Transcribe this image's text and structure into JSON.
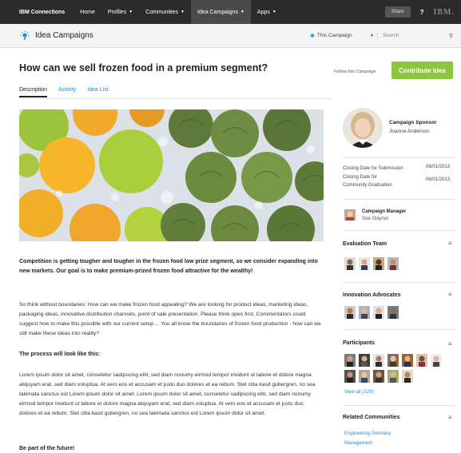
{
  "topnav": {
    "brand": "IBM Connections",
    "items": [
      {
        "label": "Home",
        "caret": false
      },
      {
        "label": "Profiles",
        "caret": true
      },
      {
        "label": "Communities",
        "caret": true
      },
      {
        "label": "Idea Campaigns",
        "caret": true,
        "active": true
      },
      {
        "label": "Apps",
        "caret": true
      }
    ],
    "share_label": "Share",
    "help_label": "?",
    "logo_text": "IBM."
  },
  "titlebar": {
    "title": "Idea Campaigns",
    "scope_label": "This Campaign",
    "search_placeholder": "Search"
  },
  "page": {
    "headline": "How can we sell frozen food in a premium segment?",
    "follow_label": "Follow this Campaign",
    "contribute_label": "Contribute Idea",
    "tabs": [
      {
        "label": "Description",
        "active": true
      },
      {
        "label": "Activity",
        "active": false
      },
      {
        "label": "Idea List",
        "active": false
      }
    ],
    "lead": "Competition is getting tougher and tougher in the frozen food low prize segment, so we consider expanding into new markets. Our goal is to make premium-prized frozen food attractive for the wealthy!",
    "para1": "So think without boundaries: How can we make frozen food appealing? We are looking for product ideas, marketing ideas, packaging ideas, innovative distribution channels, point of sale presentation. Please think open first. Commentators could suggest how to make this possible with our current setup ... You all know the boundaries of frozen food production - how can we still make these ideas into reality?",
    "process_heading": "The process will look like this:",
    "para2": "Lorem ipsum dolor sit amet, consetetur sadipscing elitr, sed diam nonumy eirmod tempor invidunt ut labore et dolore magna aliquyam erat, sed diam voluptua. At vero eos et accusam et justo duo dolores et ea rebum. Stet clita kasd gubergren, no sea takimata sanctus est Lorem ipsum dolor sit amet. Lorem ipsum dolor sit amet, consetetur sadipscing elitr, sed diam nonumy eirmod tempor invidunt ut labore et dolore magna aliquyam erat, sed diam voluptua. At vero eos et accusam et justo duo dolores et ea rebum. Stet clita kasd gubergren, no sea takimata sanctus est Lorem ipsum dolor sit amet.",
    "future_heading": "Be part of the future!"
  },
  "sidebar": {
    "sponsor_label": "Campaign Sponsor",
    "sponsor_name": "Joanne Anderson",
    "closing_submission_label": "Closing Date for Submission",
    "closing_submission_date": "06/01/2013",
    "closing_graduation_label_1": "Closing Date for",
    "closing_graduation_label_2": "Community Graduation",
    "closing_graduation_date": "06/01/2013",
    "manager_label": "Campaign Manager",
    "manager_name": "Sue Glaynor",
    "evaluation_title": "Evaluation Team",
    "advocates_title": "Innovation Advocates",
    "participants_title": "Participants",
    "view_all": "View all (320)",
    "related_title": "Related Communities",
    "related_links": [
      "Engineering Germany",
      "Management"
    ],
    "menu_glyph": "≡",
    "colors": {
      "accent_blue": "#1a8fd6",
      "contribute_green": "#8cc63f",
      "nav_dark": "#2b2b2b"
    }
  }
}
